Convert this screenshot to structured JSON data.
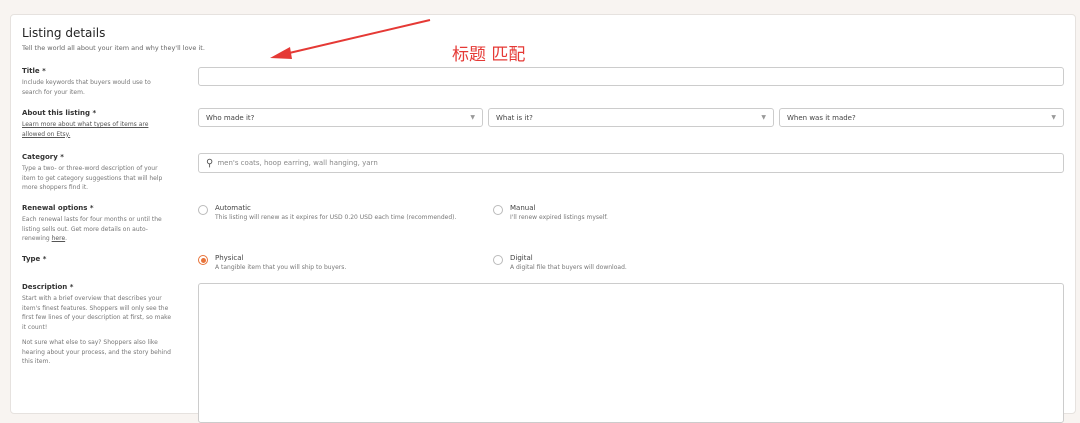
{
  "section": {
    "title": "Listing details",
    "subtitle": "Tell the world all about your item and why they'll love it."
  },
  "title_field": {
    "label": "Title *",
    "help": "Include keywords that buyers would use to search for your item.",
    "value": ""
  },
  "about": {
    "label": "About this listing *",
    "link": "Learn more about what types of items are allowed on Etsy.",
    "selects": [
      "Who made it?",
      "What is it?",
      "When was it made?"
    ]
  },
  "category": {
    "label": "Category *",
    "help": "Type a two- or three-word description of your item to get category suggestions that will help more shoppers find it.",
    "placeholder": "men's coats, hoop earring, wall hanging, yarn"
  },
  "renewal": {
    "label": "Renewal options *",
    "help": "Each renewal lasts for four months or until the listing sells out. Get more details on auto-renewing ",
    "help_link": "here",
    "help_end": ".",
    "options": [
      {
        "title": "Automatic",
        "desc": "This listing will renew as it expires for USD 0.20 USD each time (recommended).",
        "selected": false
      },
      {
        "title": "Manual",
        "desc": "I'll renew expired listings myself.",
        "selected": false
      }
    ]
  },
  "type": {
    "label": "Type *",
    "options": [
      {
        "title": "Physical",
        "desc": "A tangible item that you will ship to buyers.",
        "selected": true
      },
      {
        "title": "Digital",
        "desc": "A digital file that buyers will download.",
        "selected": false
      }
    ]
  },
  "description": {
    "label": "Description *",
    "help1": "Start with a brief overview that describes your item's finest features. Shoppers will only see the first few lines of your description at first, so make it count!",
    "help2": "Not sure what else to say? Shoppers also like hearing about your process, and the story behind this item.",
    "value": ""
  },
  "annotation": {
    "text": "标题 匹配",
    "color": "#e53935"
  }
}
